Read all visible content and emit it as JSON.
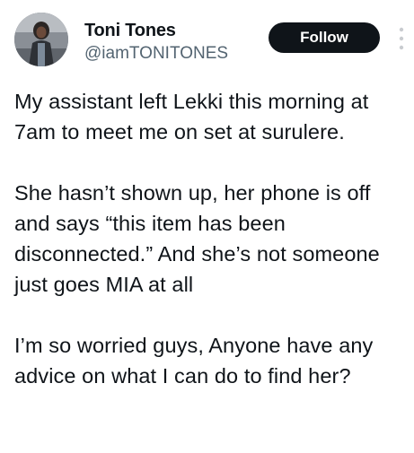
{
  "author": {
    "display_name": "Toni Tones",
    "handle": "@iamTONITONES",
    "avatar_icon": "profile-photo"
  },
  "actions": {
    "follow_label": "Follow",
    "more_icon": "more-vertical-icon"
  },
  "tweet": {
    "paragraphs": [
      "My assistant left Lekki this morning at 7am to meet me on set at surulere.",
      "She hasn’t shown up, her phone is off and says “this item has been disconnected.” And she’s not someone just goes MIA at all",
      "I’m so worried guys, Anyone have any advice on what I can do to find her?"
    ]
  },
  "colors": {
    "text": "#0f1419",
    "secondary_text": "#536471",
    "follow_button_bg": "#0f1419",
    "follow_button_text": "#ffffff"
  }
}
